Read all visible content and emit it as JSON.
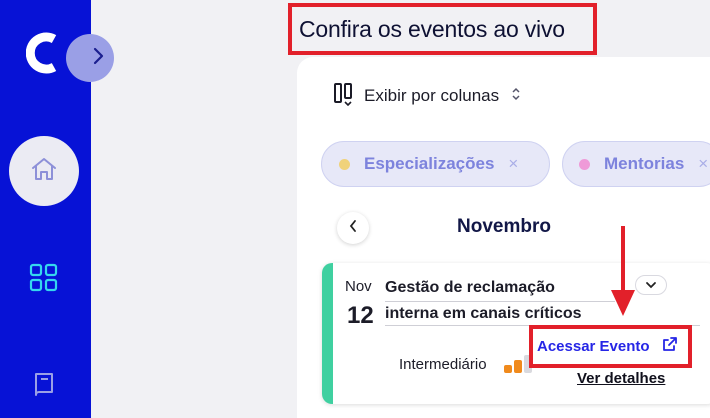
{
  "page": {
    "title": "Confira os eventos ao vivo"
  },
  "sidebar": {
    "logo_icon": "brand-logo-icon",
    "toggle_icon": "chevron-right-icon",
    "items": [
      {
        "name": "home",
        "icon": "home-icon",
        "active": true
      },
      {
        "name": "dashboard",
        "icon": "grid-icon",
        "active": false
      },
      {
        "name": "library",
        "icon": "book-icon",
        "active": false
      }
    ]
  },
  "toolbar": {
    "view_label": "Exibir por colunas"
  },
  "filters": [
    {
      "label": "Especializações",
      "color": "#f0d27a",
      "remove": "×"
    },
    {
      "label": "Mentorias",
      "color": "#ef9ad8",
      "remove": "×"
    }
  ],
  "calendar": {
    "month": "Novembro"
  },
  "event": {
    "month": "Nov",
    "day": "12",
    "title_line1": "Gestão de reclamação",
    "title_line2": "interna em canais críticos",
    "level": "Intermediário",
    "level_value": 2,
    "level_max": 3,
    "access_label": "Acessar Evento",
    "details_label": "Ver detalhes"
  },
  "colors": {
    "sidebar": "#0712d6",
    "accent_bar": "#3fd0a0",
    "link": "#2626e6",
    "highlight": "#e2202a",
    "level_bar": "#f08a1c"
  }
}
